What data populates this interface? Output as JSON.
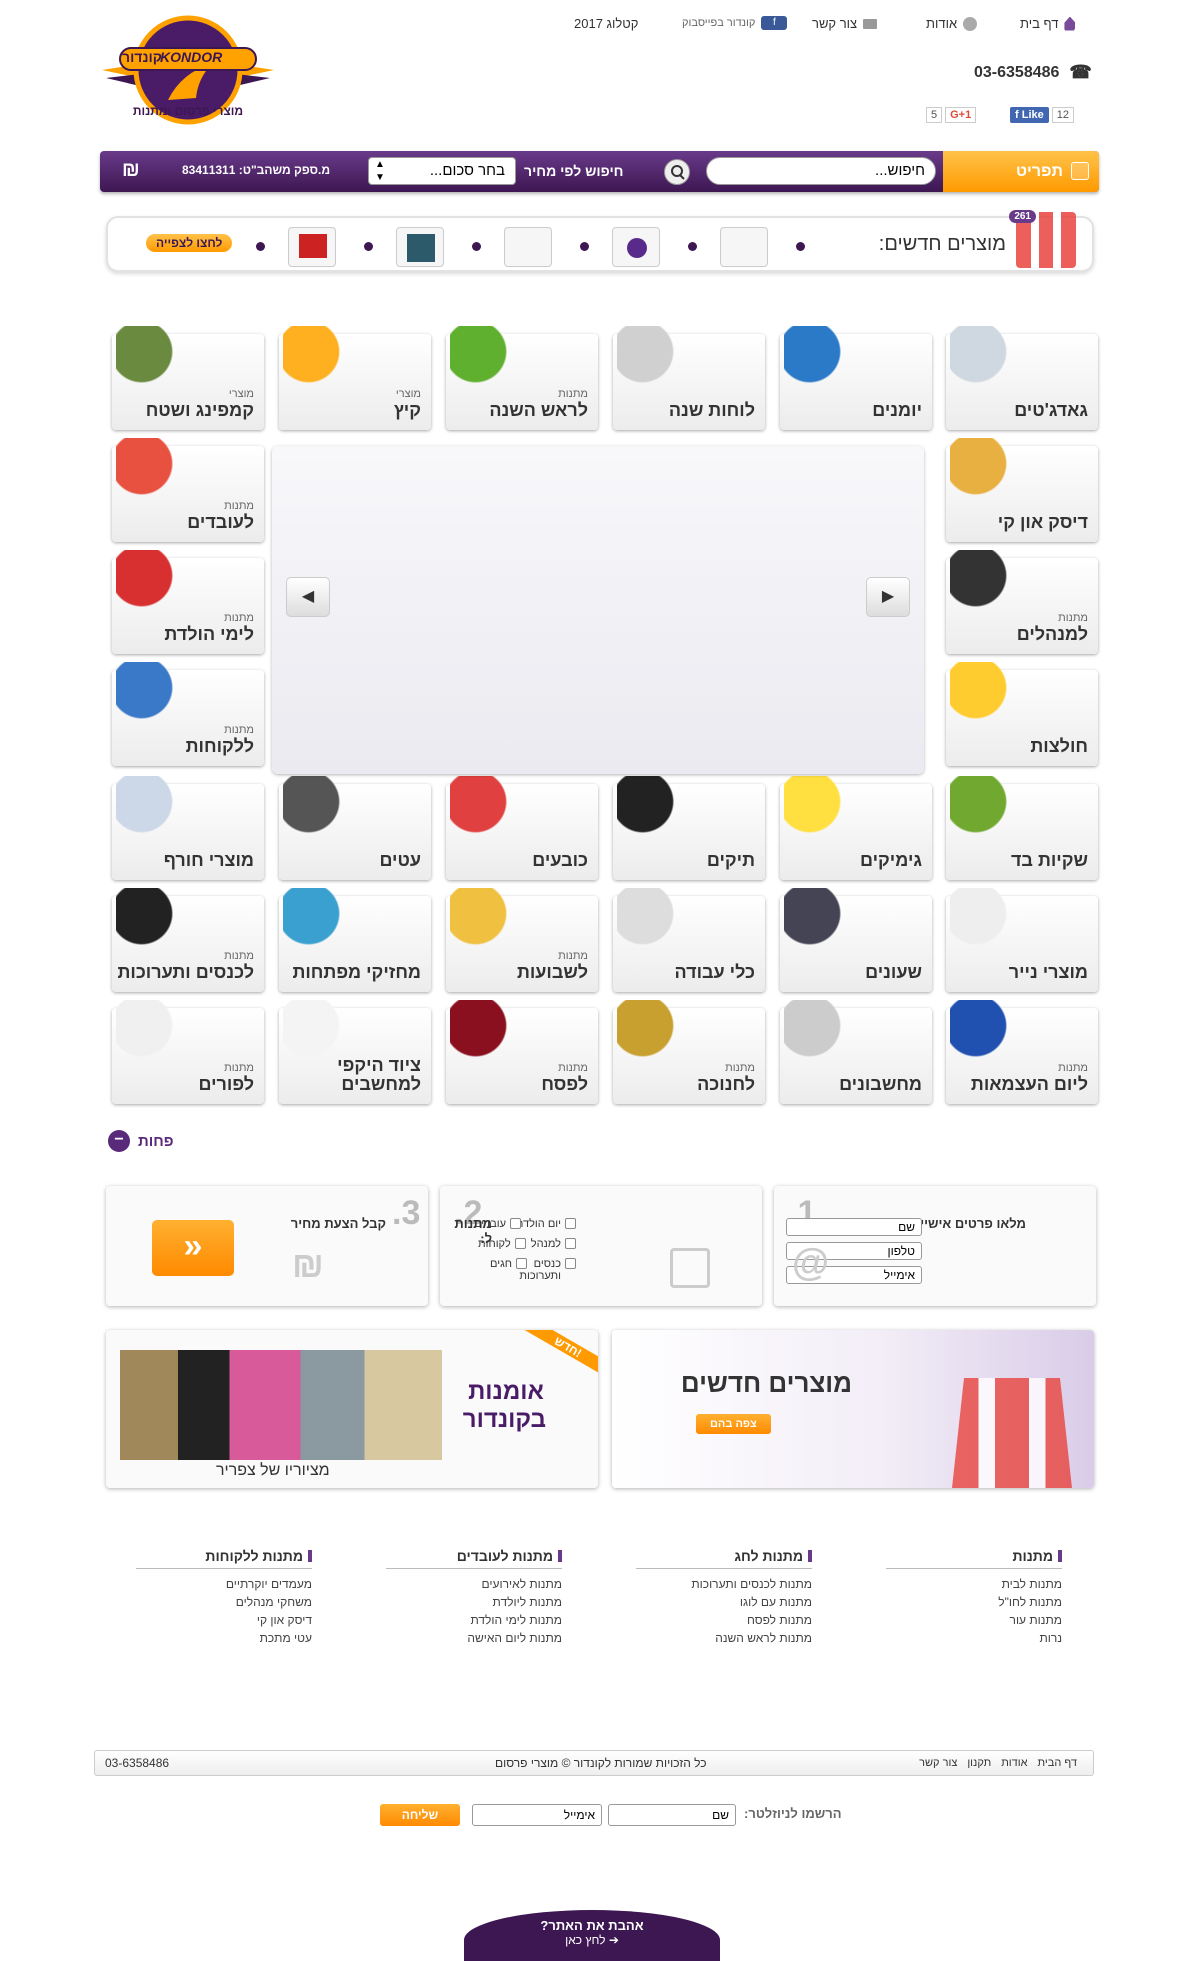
{
  "top_links": {
    "home": "דף בית",
    "about": "אודות",
    "contact": "צור קשר",
    "facebook": "קונדור בפייסבוק",
    "catalog": "קטלוג 2017"
  },
  "phone": "03-6358486",
  "social": {
    "gplus_count": "5",
    "gplus": "G+1",
    "like": "Like",
    "like_count": "12"
  },
  "logo": {
    "brand_en": "KONDOR",
    "brand_he": "קונדור",
    "tagline": "מוצרי פרסום ומתנות"
  },
  "nav": {
    "catalog": "תפריט",
    "search_placeholder": "חיפוש...",
    "price_search": "חיפוש לפי מחיר",
    "price_select": "בחר סכום...",
    "supplier": "מ.ספק משהב\"ט: 83411311",
    "shekel": "₪"
  },
  "new_products": {
    "label": "מוצרים חדשים:",
    "badge": "261",
    "view_button": "לחצו לצפייה"
  },
  "tiles": [
    {
      "small": "",
      "big": "גאדג'טים"
    },
    {
      "small": "",
      "big": "יומנים"
    },
    {
      "small": "",
      "big": "לוחות שנה"
    },
    {
      "small": "מתנות",
      "big": "לראש השנה"
    },
    {
      "small": "מוצרי",
      "big": "קיץ"
    },
    {
      "small": "מוצרי",
      "big": "קמפינג ושטח"
    },
    {
      "small": "",
      "big": "דיסק און קי"
    },
    {
      "small": "מתנות",
      "big": "לעובדים"
    },
    {
      "small": "מתנות",
      "big": "למנהלים"
    },
    {
      "small": "מתנות",
      "big": "לימי הולדת"
    },
    {
      "small": "",
      "big": "חולצות"
    },
    {
      "small": "מתנות",
      "big": "ללקוחות"
    },
    {
      "small": "",
      "big": "שקיות בד"
    },
    {
      "small": "",
      "big": "גימיקים"
    },
    {
      "small": "",
      "big": "תיקים"
    },
    {
      "small": "",
      "big": "כובעים"
    },
    {
      "small": "",
      "big": "עטים"
    },
    {
      "small": "",
      "big": "מוצרי חורף"
    },
    {
      "small": "",
      "big": "מוצרי נייר"
    },
    {
      "small": "",
      "big": "שעונים"
    },
    {
      "small": "",
      "big": "כלי עבודה"
    },
    {
      "small": "מתנות",
      "big": "לשבועות"
    },
    {
      "small": "",
      "big": "מחזיקי מפתחות"
    },
    {
      "small": "מתנות",
      "big": "לכנסים ותערוכות"
    },
    {
      "small": "מתנות",
      "big": "ליום העצמאות"
    },
    {
      "small": "",
      "big": "מחשבונים"
    },
    {
      "small": "מתנות",
      "big": "לחנוכה"
    },
    {
      "small": "מתנות",
      "big": "לפסח"
    },
    {
      "small": "",
      "big": "ציוד היקפי למחשבים"
    },
    {
      "small": "מתנות",
      "big": "לפורים"
    }
  ],
  "less_label": "פחות",
  "steps": {
    "s1": {
      "num": "1.",
      "title": "מלאו פרטים אישיים",
      "name": "שם",
      "phone": "טלפון",
      "email": "אימייל"
    },
    "s2": {
      "num": "2.",
      "title": "מתנות ל:",
      "options": [
        "יום הולדת",
        "עובדים",
        "למנהל",
        "לקוחות",
        "כנסים ותערוכות",
        "חגים"
      ]
    },
    "s3": {
      "num": "3.",
      "title": "קבל הצעת מחיר",
      "go": "«"
    }
  },
  "banners": {
    "new_title": "מוצרים חדשים",
    "new_button": "צפה בהם",
    "art_title1": "אומנות",
    "art_title2": "בקונדור",
    "art_caption": "מציוריו של צפריר",
    "art_ribbon": "חדש!"
  },
  "footer_cols": [
    {
      "title": "מתנות",
      "items": [
        "מתנות לבית",
        "מתנות לחו\"ל",
        "מתנות עור",
        "נרות"
      ]
    },
    {
      "title": "מתנות לחג",
      "items": [
        "מתנות לכנסים ותערוכות",
        "מתנות עם לוגו",
        "מתנות לפסח",
        "מתנות לראש השנה"
      ]
    },
    {
      "title": "מתנות לעובדים",
      "items": [
        "מתנות לאירועים",
        "מתנות ליולדת",
        "מתנות לימי הולדת",
        "מתנות ליום האישה"
      ]
    },
    {
      "title": "מתנות ללקוחות",
      "items": [
        "מעמדים יוקרתיים",
        "משחקי מנהלים",
        "דיסק און קי",
        "עטי מתכת"
      ]
    }
  ],
  "bottom": {
    "links": [
      "דף הבית",
      "אודות",
      "תקנון",
      "צור קשר"
    ],
    "copyright": "כל הזכויות שמורות לקונדור © מוצרי פרסום",
    "phone": "03-6358486"
  },
  "newsletter": {
    "label": "הרשמו לניוזלטר:",
    "name": "שם",
    "email": "אימייל",
    "submit": "שליחה"
  },
  "love": {
    "q": "אהבת את האתר?",
    "cta": "לחץ כאן"
  },
  "colors": {
    "purple": "#3d1752",
    "orange": "#ff9a00"
  }
}
